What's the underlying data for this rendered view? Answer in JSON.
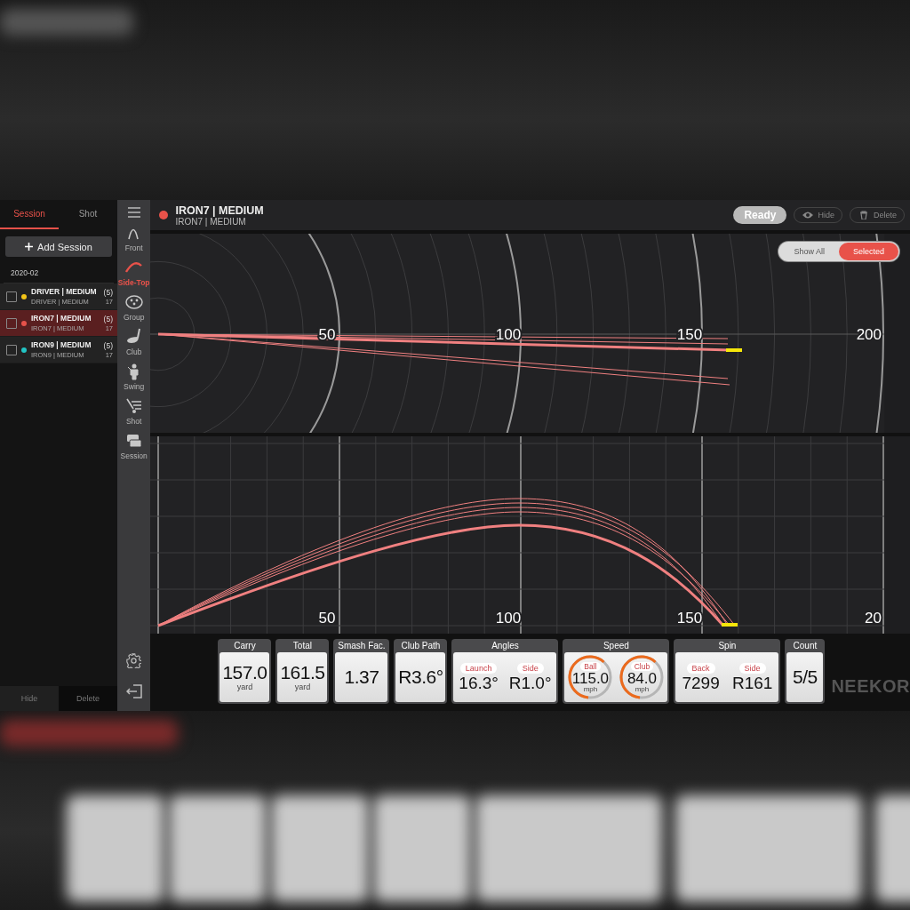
{
  "sidebar": {
    "tabs": [
      {
        "label": "Session",
        "selected": true
      },
      {
        "label": "Shot",
        "selected": false
      }
    ],
    "add_button": "Add Session",
    "group_label": "2020-02",
    "sessions": [
      {
        "name": "DRIVER | MEDIUM",
        "subtitle": "DRIVER | MEDIUM",
        "count": "(5)",
        "number": "17",
        "color": "#f2c418",
        "selected": false,
        "checked": false
      },
      {
        "name": "IRON7 | MEDIUM",
        "subtitle": "IRON7 | MEDIUM",
        "count": "(5)",
        "number": "17",
        "color": "#e8524a",
        "selected": true,
        "checked": false
      },
      {
        "name": "IRON9 | MEDIUM",
        "subtitle": "IRON9 | MEDIUM",
        "count": "(5)",
        "number": "17",
        "color": "#22c4c4",
        "selected": false,
        "checked": false
      }
    ],
    "footer_buttons": [
      "Hide",
      "Delete"
    ]
  },
  "nav": {
    "items": [
      {
        "kind": "front",
        "label": "Front",
        "selected": false
      },
      {
        "kind": "side-top",
        "label": "Side-Top",
        "selected": true
      },
      {
        "kind": "group",
        "label": "Group",
        "selected": false
      },
      {
        "kind": "club",
        "label": "Club",
        "selected": false
      },
      {
        "kind": "swing",
        "label": "Swing",
        "selected": false
      },
      {
        "kind": "shot",
        "label": "Shot",
        "selected": false
      },
      {
        "kind": "session",
        "label": "Session",
        "selected": false
      }
    ]
  },
  "header": {
    "title": "IRON7 | MEDIUM",
    "subtitle": "IRON7 | MEDIUM",
    "color": "#e8524a",
    "status": "Ready",
    "buttons": [
      "Hide",
      "Delete"
    ]
  },
  "top_view": {
    "toggle": [
      {
        "label": "Show All",
        "selected": false
      },
      {
        "label": "Selected",
        "selected": true
      }
    ],
    "distance_labels": [
      "50",
      "100",
      "150",
      "200"
    ]
  },
  "side_view": {
    "distance_labels": [
      "50",
      "100",
      "150",
      "20"
    ]
  },
  "stats": [
    {
      "kind": "single",
      "title": "Carry",
      "value": "157.0",
      "unit": "yard"
    },
    {
      "kind": "single",
      "title": "Total",
      "value": "161.5",
      "unit": "yard"
    },
    {
      "kind": "single",
      "title": "Smash Fac.",
      "value": "1.37"
    },
    {
      "kind": "single",
      "title": "Club Path",
      "value": "R3.6°"
    },
    {
      "kind": "pair",
      "title": "Angles",
      "items": [
        {
          "label": "Launch",
          "value": "16.3°"
        },
        {
          "label": "Side",
          "value": "R1.0°"
        }
      ]
    },
    {
      "kind": "gauge",
      "title": "Speed",
      "items": [
        {
          "label": "Ball",
          "value": "115.0",
          "unit": "mph"
        },
        {
          "label": "Club",
          "value": "84.0",
          "unit": "mph"
        }
      ]
    },
    {
      "kind": "pair",
      "title": "Spin",
      "items": [
        {
          "label": "Back",
          "value": "7299"
        },
        {
          "label": "Side",
          "value": "R161"
        }
      ]
    },
    {
      "kind": "single",
      "title": "Count",
      "value": "5/5"
    }
  ],
  "brand": "NEEKOR"
}
